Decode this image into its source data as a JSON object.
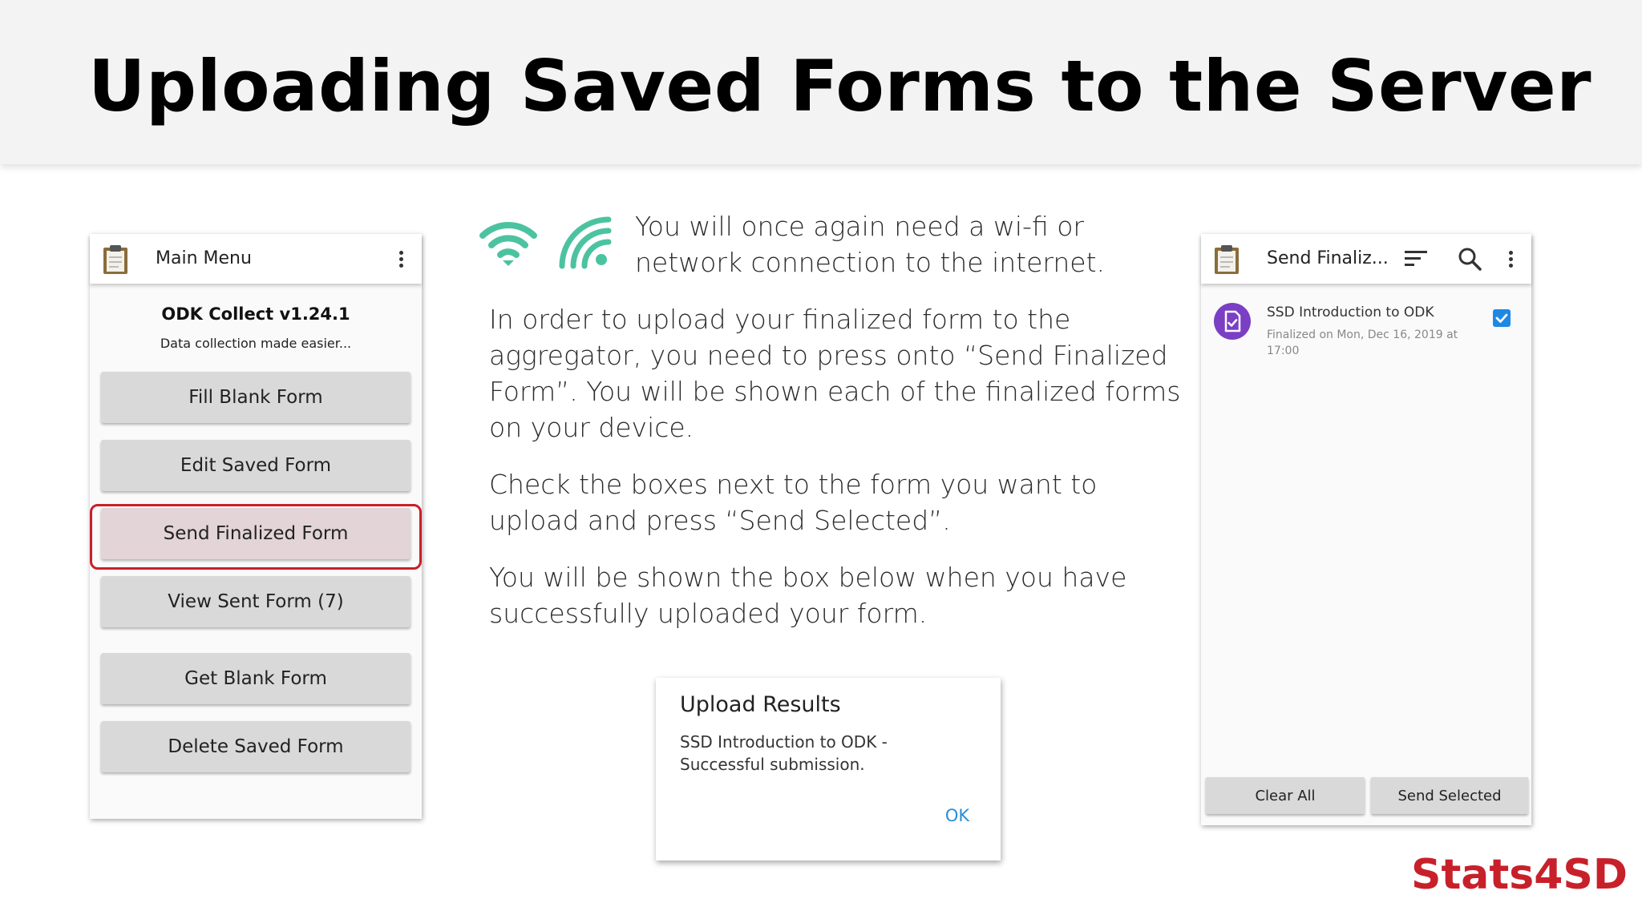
{
  "slide": {
    "title": "Uploading Saved Forms to the Server",
    "logo_text": "Stats4SD"
  },
  "main_menu": {
    "appbar_title": "Main Menu",
    "app_name": "ODK Collect v1.24.1",
    "tagline": "Data collection made easier...",
    "buttons": [
      {
        "label": "Fill Blank Form"
      },
      {
        "label": "Edit Saved Form"
      },
      {
        "label": "Send Finalized Form",
        "highlighted": true
      },
      {
        "label": "View Sent Form (7)"
      },
      {
        "label": "Get Blank Form"
      },
      {
        "label": "Delete Saved Form"
      }
    ]
  },
  "instructions": {
    "network_note": "You will once again need a wi-fi or network connection to the internet.",
    "para1": "In order to upload your finalized form to the aggregator, you need to press onto “Send Finalized Form”. You will be shown each of the finalized forms on your device.",
    "para2": "Check the boxes next to the form you want to upload and press “Send Selected”.",
    "para3": "You will be shown the box below when you have successfully uploaded your form."
  },
  "upload_dialog": {
    "title": "Upload Results",
    "message": "SSD Introduction to ODK - Successful submission.",
    "ok_label": "OK"
  },
  "send_finalized": {
    "appbar_title": "Send Finaliz...",
    "form": {
      "name": "SSD Introduction to ODK",
      "subtitle": "Finalized on Mon, Dec 16, 2019 at 17:00",
      "checked": true
    },
    "clear_all_label": "Clear All",
    "send_selected_label": "Send Selected"
  },
  "colors": {
    "accent_red": "#c8202a",
    "wifi_green": "#4cc3a0",
    "form_icon_purple": "#7b3fc4",
    "checkbox_blue": "#1e88e5",
    "ok_blue": "#2a8fd6"
  },
  "icons": {
    "wifi": "wifi-icon",
    "signal": "signal-icon",
    "clipboard": "clipboard-icon",
    "sort": "sort-icon",
    "search": "search-icon",
    "more": "more-vert-icon",
    "form": "form-icon",
    "checkbox": "checkbox-checked-icon"
  }
}
